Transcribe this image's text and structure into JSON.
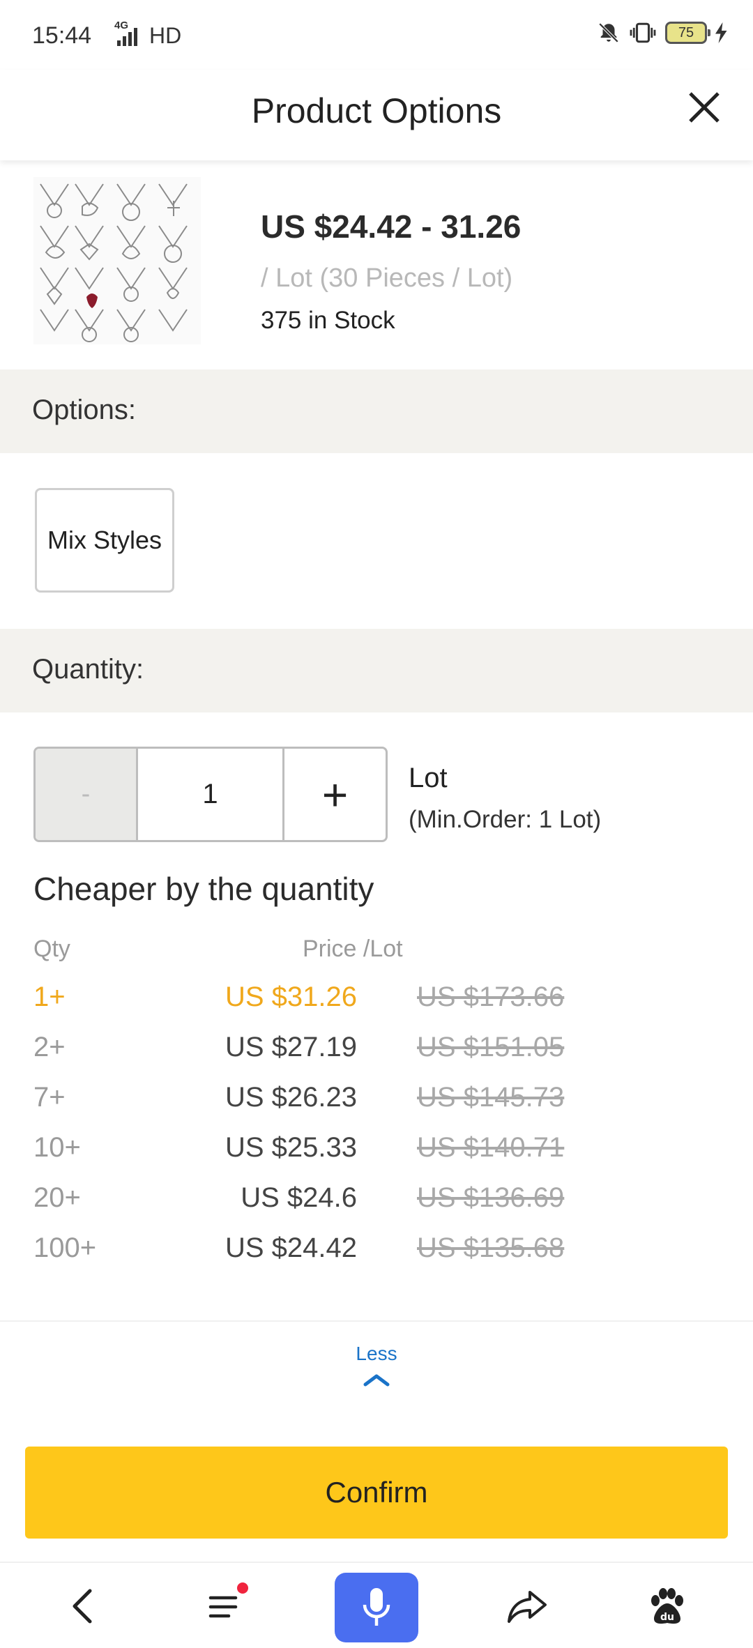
{
  "status_bar": {
    "time": "15:44",
    "network": "4G",
    "hd": "HD",
    "battery": "75"
  },
  "header": {
    "title": "Product Options",
    "close_icon": "close-icon"
  },
  "product": {
    "price_range": "US $24.42 - 31.26",
    "unit_info": "/ Lot (30 Pieces / Lot)",
    "stock": "375 in Stock"
  },
  "options": {
    "label": "Options:",
    "items": [
      {
        "label": "Mix Styles"
      }
    ]
  },
  "quantity": {
    "label": "Quantity:",
    "minus": "-",
    "value": "1",
    "plus": "+",
    "unit": "Lot",
    "min_order": "(Min.Order: 1 Lot)"
  },
  "tiers": {
    "title": "Cheaper by the quantity",
    "header_qty": "Qty",
    "header_price": "Price /Lot",
    "rows": [
      {
        "qty": "1+",
        "price": "US $31.26",
        "original": "US $173.66",
        "active": true
      },
      {
        "qty": "2+",
        "price": "US $27.19",
        "original": "US $151.05"
      },
      {
        "qty": "7+",
        "price": "US $26.23",
        "original": "US $145.73"
      },
      {
        "qty": "10+",
        "price": "US $25.33",
        "original": "US $140.71"
      },
      {
        "qty": "20+",
        "price": "US $24.6",
        "original": "US $136.69"
      },
      {
        "qty": "100+",
        "price": "US $24.42",
        "original": "US $135.68"
      }
    ]
  },
  "less_toggle": {
    "label": "Less",
    "icon": "chevron-up-icon"
  },
  "confirm": {
    "label": "Confirm"
  },
  "bottom_nav": {
    "items": [
      "back-icon",
      "menu-icon",
      "microphone-icon",
      "share-icon",
      "baidu-paw-icon"
    ]
  },
  "colors": {
    "accent": "#fec71a",
    "tier_highlight": "#f0a81c",
    "link": "#1a73c8",
    "mic_button": "#4a6ef0",
    "section_bg": "#f3f2ee"
  }
}
